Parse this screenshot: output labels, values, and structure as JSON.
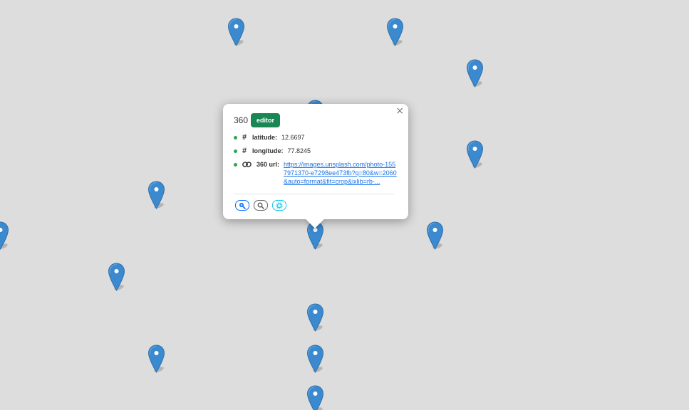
{
  "map": {
    "marker_icon": "map-pin-icon",
    "marker_color": "#3b8ad0",
    "marker_count": 15
  },
  "popup": {
    "title": "360",
    "badge": "editor",
    "badge_color": "#198754",
    "close_label": "×",
    "rows": [
      {
        "icon": "hash-icon",
        "label": "latitude:",
        "value": "12.6697"
      },
      {
        "icon": "hash-icon",
        "label": "longitude:",
        "value": "77.8245"
      },
      {
        "icon": "link-icon",
        "label": "360 url:",
        "value": "https://images.unsplash.com/photo-1557971370-e7298ee473fb?q=80&w=2060&auto=format&fit=crop&ixlib=rb-..."
      }
    ],
    "actions": [
      {
        "icon": "zoom-in-icon",
        "color": "#0d6efd"
      },
      {
        "icon": "search-icon",
        "color": "#666666"
      },
      {
        "icon": "gear-icon",
        "color": "#0dcaf0"
      }
    ]
  }
}
